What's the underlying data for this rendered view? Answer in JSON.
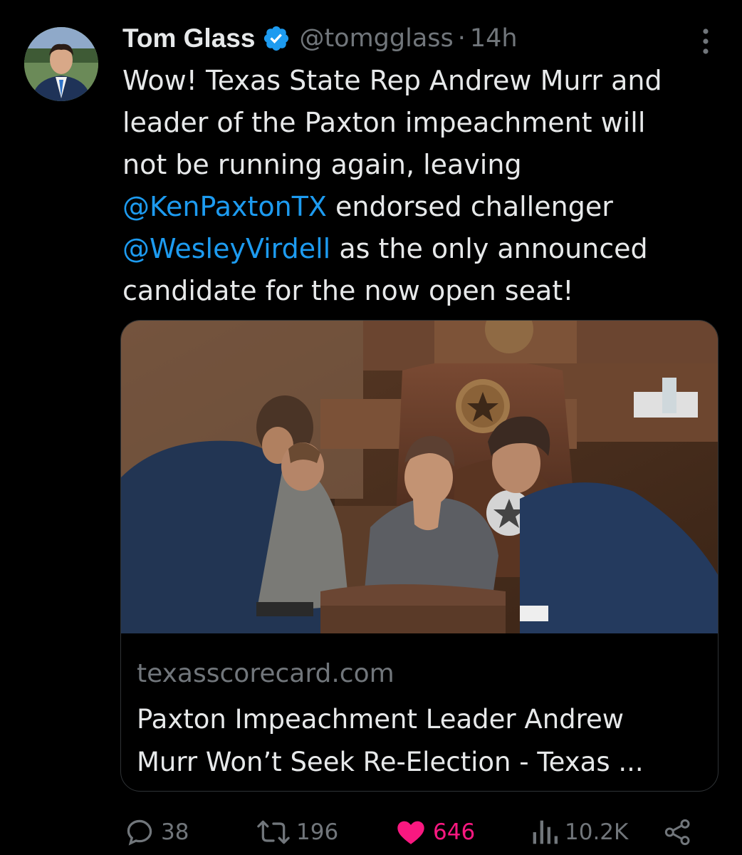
{
  "author": {
    "name": "Tom Glass",
    "handle": "@tomgglass",
    "separator": "·",
    "time": "14h",
    "verified": true
  },
  "tweet": {
    "lines": [
      [
        {
          "t": "Wow!  Texas State Rep Andrew Murr and"
        }
      ],
      [
        {
          "t": "leader of the Paxton impeachment will"
        }
      ],
      [
        {
          "t": "not be running again, leaving"
        }
      ],
      [
        {
          "t": "@KenPaxtonTX",
          "m": true
        },
        {
          "t": " endorsed challenger"
        }
      ],
      [
        {
          "t": "@WesleyVirdell",
          "m": true
        },
        {
          "t": " as the only announced"
        }
      ],
      [
        {
          "t": "candidate for the now open seat!"
        }
      ]
    ]
  },
  "card": {
    "domain": "texasscorecard.com",
    "title_lines": [
      "Paxton Impeachment Leader Andrew",
      "Murr Won’t Seek Re-Election - Texas ..."
    ]
  },
  "actions": {
    "replies": "38",
    "retweets": "196",
    "likes": "646",
    "views": "10.2K"
  },
  "colors": {
    "background": "#000000",
    "text": "#e7e9ea",
    "muted": "#71767b",
    "mention": "#1d9bf0",
    "like": "#f91880"
  },
  "icons": [
    "verified-badge-icon",
    "more-options-icon",
    "reply-icon",
    "retweet-icon",
    "like-heart-icon",
    "views-icon",
    "share-icon"
  ]
}
